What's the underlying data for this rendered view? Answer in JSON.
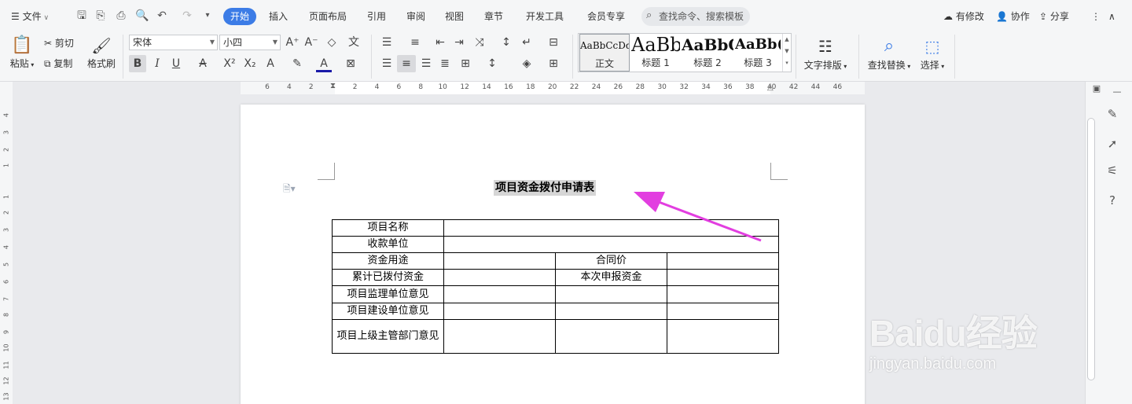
{
  "menubar": {
    "file_label": "文件",
    "tabs": [
      "开始",
      "插入",
      "页面布局",
      "引用",
      "审阅",
      "视图",
      "章节",
      "开发工具",
      "会员专享"
    ],
    "search_placeholder": "查找命令、搜索模板",
    "modified_label": "有修改",
    "collab_label": "协作",
    "share_label": "分享"
  },
  "ribbon": {
    "paste_label": "粘贴",
    "cut_label": "剪切",
    "copy_label": "复制",
    "format_painter_label": "格式刷",
    "font_name": "宋体",
    "font_size": "小四",
    "styles": [
      {
        "preview": "AaBbCcDd",
        "label": "正文"
      },
      {
        "preview": "AaBb",
        "label": "标题 1"
      },
      {
        "preview": "AaBbC",
        "label": "标题 2"
      },
      {
        "preview": "AaBb(",
        "label": "标题 3"
      }
    ],
    "text_layout_label": "文字排版",
    "find_replace_label": "查找替换",
    "select_label": "选择"
  },
  "ruler": {
    "h_ticks": [
      "6",
      "4",
      "2",
      "",
      "2",
      "4",
      "6",
      "8",
      "10",
      "12",
      "14",
      "16",
      "18",
      "20",
      "22",
      "24",
      "26",
      "28",
      "30",
      "32",
      "34",
      "36",
      "38",
      "40",
      "42",
      "44",
      "46"
    ],
    "v_ticks": [
      "1",
      "2",
      "3",
      "4",
      "1",
      "1",
      "2",
      "3",
      "4",
      "5",
      "6",
      "7",
      "8",
      "9",
      "10",
      "11",
      "12",
      "13"
    ]
  },
  "document": {
    "title": "项目资金拨付申请表",
    "rows": [
      {
        "a": "项目名称",
        "b": "",
        "c": "",
        "d": ""
      },
      {
        "a": "收款单位",
        "b": "",
        "c": "",
        "d": ""
      },
      {
        "a": "资金用途",
        "b": "",
        "c": "合同价",
        "d": ""
      },
      {
        "a": "累计已拨付资金",
        "b": "",
        "c": "本次申报资金",
        "d": ""
      },
      {
        "a": "项目监理单位意见",
        "b": "",
        "c": "",
        "d": ""
      },
      {
        "a": "项目建设单位意见",
        "b": "",
        "c": "",
        "d": ""
      },
      {
        "a": "项目上级主管部门意见",
        "b": "",
        "c": "",
        "d": ""
      }
    ]
  },
  "watermark": {
    "brand": "Baidu经验",
    "url": "jingyan.baidu.com"
  },
  "colors": {
    "accent": "#3c7ce6",
    "arrow": "#e23ee0",
    "title_highlight": "#d6d6d6"
  }
}
